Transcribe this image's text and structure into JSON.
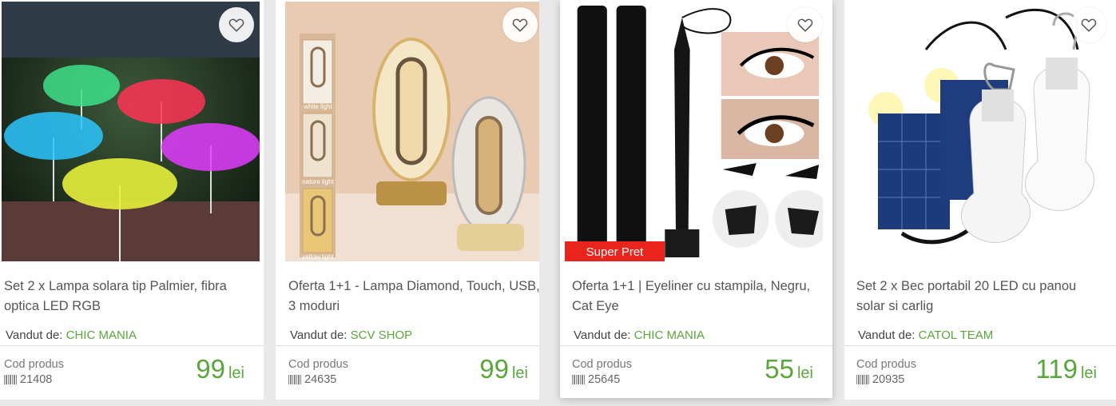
{
  "products": [
    {
      "title": "Set 2 x Lampa solara tip Palmier, fibra optica LED RGB",
      "seller_prefix": "Vandut de:",
      "seller": "CHIC MANIA",
      "code_label": "Cod produs",
      "code": "21408",
      "price": "99",
      "currency": "lei"
    },
    {
      "title": "Oferta 1+1 - Lampa Diamond, Touch, USB, 3 moduri",
      "seller_prefix": "Vandut de:",
      "seller": "SCV SHOP",
      "code_label": "Cod produs",
      "code": "24635",
      "price": "99",
      "currency": "lei",
      "image_labels": [
        "white light",
        "nature light",
        "yellow light"
      ]
    },
    {
      "title": "Oferta 1+1 | Eyeliner cu stampila, Negru, Cat Eye",
      "seller_prefix": "Vandut de:",
      "seller": "CHIC MANIA",
      "code_label": "Cod produs",
      "code": "25645",
      "price": "55",
      "currency": "lei",
      "badge": "Super Pret"
    },
    {
      "title": "Set 2 x Bec portabil 20 LED cu panou solar si carlig",
      "seller_prefix": "Vandut de:",
      "seller": "CATOL TEAM",
      "code_label": "Cod produs",
      "code": "20935",
      "price": "119",
      "currency": "lei"
    }
  ],
  "colors": {
    "accent_green": "#5aa63c",
    "badge_red": "#e8241c"
  },
  "icons": {
    "favorite": "heart-outline-icon",
    "code": "barcode-icon"
  }
}
